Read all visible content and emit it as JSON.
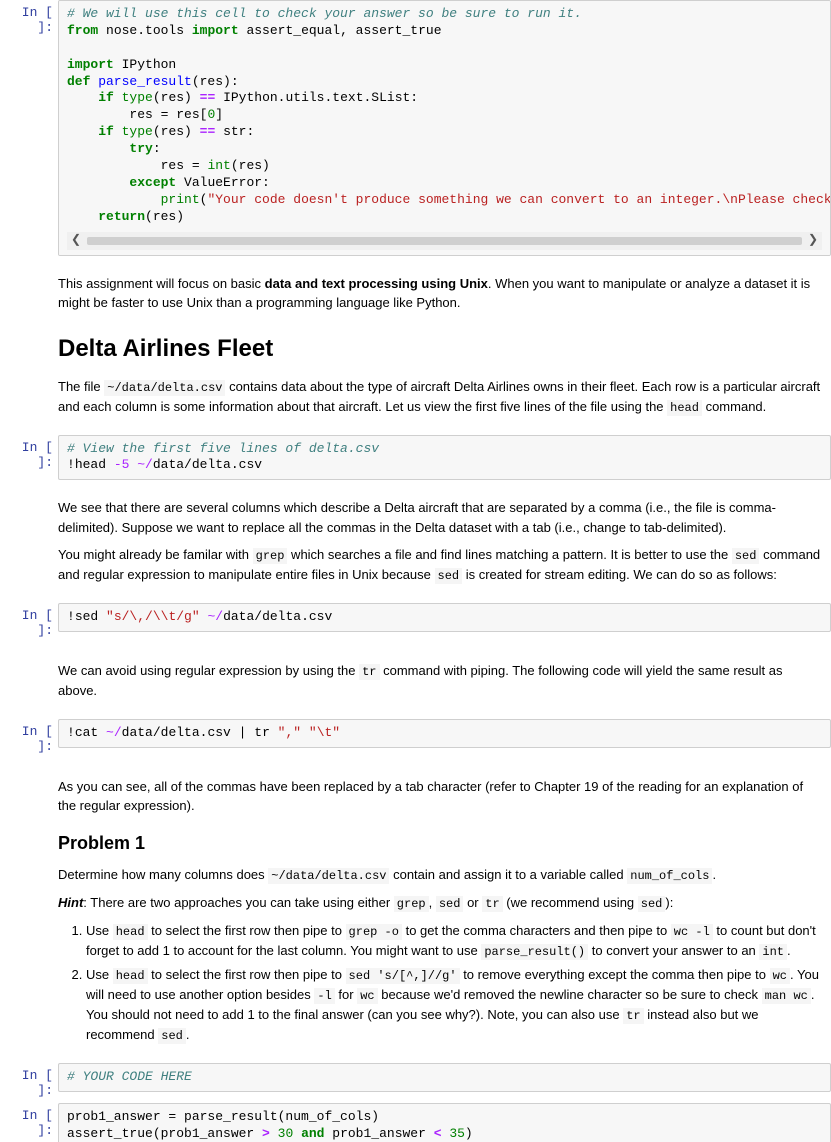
{
  "prompt_label": "In [ ]:",
  "cell1_line1": "# We will use this cell to check your answer so be sure to run it.",
  "cell1_from": "from",
  "cell1_nose": " nose.tools ",
  "cell1_import": "import",
  "cell1_names": " assert_equal, assert_true",
  "cell1_imp2": " IPython",
  "cell1_def": "def",
  "cell1_fn": " parse_result",
  "cell1_args": "(res):",
  "cell1_if": "if",
  "cell1_type": " type",
  "cell1_resarg": "(res) ",
  "cell1_eq": "==",
  "cell1_slist": " IPython.utils.text.SList:",
  "cell1_assign": "        res = res[",
  "cell1_zero": "0",
  "cell1_close": "]",
  "cell1_str": " str:",
  "cell1_try": "try",
  "cell1_colon": ":",
  "cell1_int": "int",
  "cell1_resassign": "            res = ",
  "cell1_reswrap": "(res)",
  "cell1_except": "except",
  "cell1_valerr": " ValueError:",
  "cell1_print": "print",
  "cell1_msg": "\"Your code doesn't produce something we can convert to an integer.\\nPlease check your result and try a",
  "cell1_return": "return",
  "cell1_retres": "(res)",
  "md1_a": "This assignment will focus on basic ",
  "md1_b": "data and text processing using Unix",
  "md1_c": ". When you want to manipulate or analyze a dataset it is might be faster to use Unix than a programming language like Python.",
  "h1": "Delta Airlines Fleet",
  "md2_a": "The file ",
  "md2_path": "~/data/delta.csv",
  "md2_b": " contains data about the type of aircraft Delta Airlines owns in their fleet. Each row is a particular aircraft and each column is some information about that aircraft. Let us view the first five lines of the file using the ",
  "md2_head": "head",
  "md2_c": " command.",
  "cell2_comment": "# View the first five lines of delta.csv",
  "cell2_bang": "!",
  "cell2_head": "head ",
  "cell2_flag": "-5",
  "cell2_tilde": " ~/",
  "cell2_path": "data/delta.csv",
  "md3": "We see that there are several columns which describe a Delta aircraft that are separated by a comma (i.e., the file is comma-delimited). Suppose we want to replace all the commas in the Delta dataset with a tab (i.e., change to tab-delimited).",
  "md4_a": "You might already be familar with ",
  "md4_grep": "grep",
  "md4_b": " which searches a file and find lines matching a pattern. It is better to use the ",
  "md4_sed": "sed",
  "md4_c": " command and regular expression to manipulate entire files in Unix because ",
  "md4_d": " is created for stream editing. We can do so as follows:",
  "cell3_sed": "sed ",
  "cell3_pattern": "\"s/\\,/\\\\t/g\"",
  "md5_a": "We can avoid using regular expression by using the ",
  "md5_tr": "tr",
  "md5_b": " command with piping. The following code will yield the same result as above.",
  "cell4_cat": "cat ",
  "cell4_pipe": " | tr ",
  "cell4_comma": "\",\"",
  "cell4_sp": " ",
  "cell4_tab": "\"\\t\"",
  "md6": "As you can see, all of the commas have been replaced by a tab character (refer to Chapter 19 of the reading for an explanation of the regular expression).",
  "h2": "Problem 1",
  "md7_a": "Determine how many columns does ",
  "md7_b": " contain and assign it to a variable called ",
  "md7_var": "num_of_cols",
  "md7_c": ".",
  "md8_hint": "Hint",
  "md8_a": ": There are two approaches you can take using either ",
  "md8_b": ", ",
  "md8_c": " or ",
  "md8_d": " (we recommend using ",
  "md8_e": "):",
  "li1_a": "Use ",
  "li1_head": "head",
  "li1_b": " to select the first row then pipe to ",
  "li1_grepo": "grep -o",
  "li1_c": " to get the comma characters and then pipe to ",
  "li1_wcl": "wc -l",
  "li1_d": " to count but don't forget to add 1 to account for the last column. You might want to use ",
  "li1_parse": "parse_result()",
  "li1_e": " to convert your answer to an ",
  "li1_int": "int",
  "li1_f": ".",
  "li2_a": "Use ",
  "li2_b": " to select the first row then pipe to ",
  "li2_sedpat": "sed 's/[^,]//g'",
  "li2_c": " to remove everything except the comma then pipe to ",
  "li2_wc": "wc",
  "li2_d": ". You will need to use another option besides ",
  "li2_dashl": "-l",
  "li2_e": " for ",
  "li2_f": " because we'd removed the newline character so be sure to check ",
  "li2_man": "man wc",
  "li2_g": ". You should not need to add 1 to the final answer (can you see why?). Note, you can also use ",
  "li2_h": " instead also but we recommend ",
  "li2_i": ".",
  "cell5": "# YOUR CODE HERE",
  "cell6_a": "prob1_answer = parse_result(num_of_cols)",
  "cell6_b": "assert_true(prob1_answer ",
  "cell6_gt": ">",
  "cell6_30": " 30",
  "cell6_and": " and ",
  "cell6_c": "prob1_answer ",
  "cell6_lt": "<",
  "cell6_35": " 35",
  "cell6_close": ")"
}
